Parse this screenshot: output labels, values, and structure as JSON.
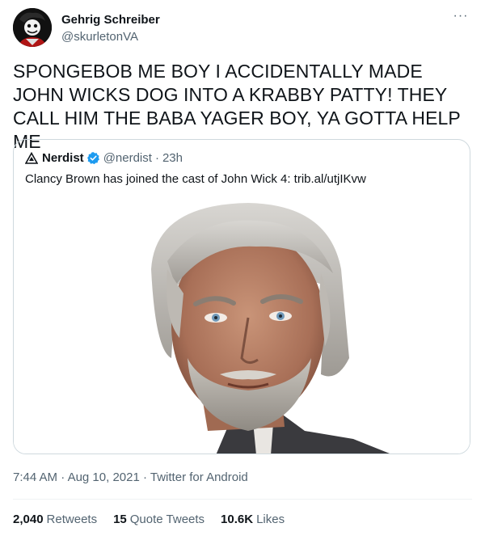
{
  "author": {
    "name": "Gehrig Schreiber",
    "handle": "@skurletonVA"
  },
  "tweet": {
    "text": "SPONGEBOB ME BOY I ACCIDENTALLY MADE JOHN WICKS DOG INTO A KRABBY PATTY! THEY CALL HIM THE BABA YAGER BOY, YA GOTTA HELP ME"
  },
  "more_label": "···",
  "quote": {
    "name": "Nerdist",
    "handle": "@nerdist",
    "separator": "·",
    "time": "23h",
    "text": "Clancy Brown has joined the cast of John Wick 4: trib.al/utjIKvw"
  },
  "meta": {
    "time": "7:44 AM",
    "separator": "·",
    "date": "Aug 10, 2021",
    "separator2": "·",
    "source": "Twitter for Android"
  },
  "stats": {
    "retweets_count": "2,040",
    "retweets_label": "Retweets",
    "quotes_count": "15",
    "quotes_label": "Quote Tweets",
    "likes_count": "10.6K",
    "likes_label": "Likes"
  },
  "icons": {
    "avatar": "avatar",
    "more": "more-icon",
    "quote_logo": "nerdist-logo-icon",
    "verified": "verified-badge-icon"
  },
  "colors": {
    "text": "#0f1419",
    "muted": "#536471",
    "border": "#cfd9de",
    "verified": "#1d9bf0"
  }
}
